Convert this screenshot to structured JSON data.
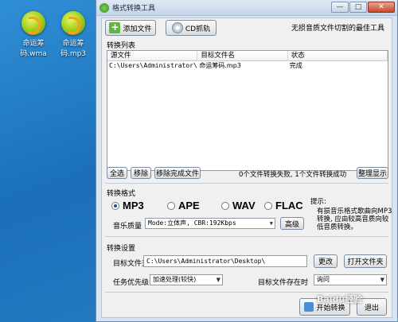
{
  "desktop": {
    "icons": [
      {
        "label": "命运筹码.wma"
      },
      {
        "label": "命运筹码.mp3"
      }
    ]
  },
  "window": {
    "title": "格式转换工具",
    "controls": {
      "minimize": "—",
      "maximize": "□",
      "close": "✕"
    }
  },
  "toolbar": {
    "add_file": "添加文件",
    "cd_rip": "CD抓轨",
    "tagline": "无损音质文件切割的最佳工具"
  },
  "convert_list": {
    "label": "转换列表",
    "columns": [
      "源文件",
      "目标文件名",
      "状态"
    ],
    "rows": [
      {
        "source": "C:\\Users\\Administrator\\D...",
        "target": "命运筹码.mp3",
        "status": "完成"
      }
    ]
  },
  "list_actions": {
    "select_all": "全选",
    "remove": "移除",
    "remove_completed": "移除完成文件",
    "status_text": "0个文件转换失败, 1个文件转换成功",
    "tidy": "整理显示"
  },
  "format": {
    "label": "转换格式",
    "options": [
      "MP3",
      "APE",
      "WAV",
      "FLAC"
    ],
    "selected": "MP3",
    "quality_label": "音乐质量",
    "quality_value": "Mode:立体声, CBR:192Kbps",
    "advanced": "高级",
    "hint_title": "提示:",
    "hint_body": "有损音乐格式歌曲向MP3转换, 应由较高音质向较低音质转换。"
  },
  "settings": {
    "label": "转换设置",
    "target_folder_label": "目标文件夹",
    "target_folder_value": "C:\\Users\\Administrator\\Desktop\\",
    "change": "更改",
    "open_folder": "打开文件夹",
    "priority_label": "任务优先级",
    "priority_value": "加速处理(较快)",
    "exists_label": "目标文件存在时",
    "exists_value": "询问"
  },
  "footer": {
    "start": "开始转换",
    "exit": "退出"
  },
  "watermark": "Baidu经验"
}
